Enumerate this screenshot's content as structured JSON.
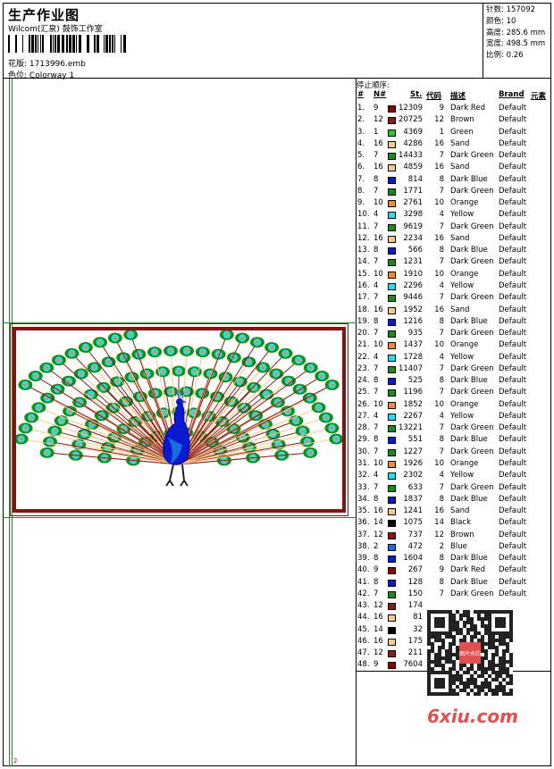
{
  "header": {
    "title": "生产作业图",
    "company": "Wilcom(汇泉) 鼓饰工作室",
    "design_label": "花版:",
    "design_value": "1713996.emb",
    "colorway_label": "色位:",
    "colorway_value": "Colorway 1"
  },
  "stats": [
    {
      "label": "针数:",
      "value": "157092"
    },
    {
      "label": "颜色:",
      "value": "10"
    },
    {
      "label": "高度:",
      "value": "285.6 mm"
    },
    {
      "label": "宽度:",
      "value": "498.5 mm"
    },
    {
      "label": "比例:",
      "value": "0.26"
    }
  ],
  "stop_sequence": {
    "title": "停止顺序:",
    "columns": {
      "num": "#",
      "needle": "N#",
      "stitches": "St.",
      "code": "代码",
      "desc": "描述",
      "brand": "Brand",
      "element": "元素"
    },
    "colors": {
      "9": "#8b0000",
      "12": "#8b1a1a",
      "1": "#22cc22",
      "16": "#f7c98a",
      "7": "#1a8a1a",
      "8": "#0a1ad0",
      "10": "#f08a3a",
      "4": "#22e0e8",
      "14": "#000000",
      "2": "#1a6ae0"
    },
    "rows": [
      {
        "n": "1.",
        "nd": "9",
        "st": "12309",
        "code": "9",
        "desc": "Dark Red",
        "brand": "Default"
      },
      {
        "n": "2.",
        "nd": "12",
        "st": "20725",
        "code": "12",
        "desc": "Brown",
        "brand": "Default"
      },
      {
        "n": "3.",
        "nd": "1",
        "st": "4369",
        "code": "1",
        "desc": "Green",
        "brand": "Default"
      },
      {
        "n": "4.",
        "nd": "16",
        "st": "4286",
        "code": "16",
        "desc": "Sand",
        "brand": "Default"
      },
      {
        "n": "5.",
        "nd": "7",
        "st": "14433",
        "code": "7",
        "desc": "Dark Green",
        "brand": "Default"
      },
      {
        "n": "6.",
        "nd": "16",
        "st": "4859",
        "code": "16",
        "desc": "Sand",
        "brand": "Default"
      },
      {
        "n": "7.",
        "nd": "8",
        "st": "814",
        "code": "8",
        "desc": "Dark Blue",
        "brand": "Default"
      },
      {
        "n": "8.",
        "nd": "7",
        "st": "1771",
        "code": "7",
        "desc": "Dark Green",
        "brand": "Default"
      },
      {
        "n": "9.",
        "nd": "10",
        "st": "2761",
        "code": "10",
        "desc": "Orange",
        "brand": "Default"
      },
      {
        "n": "10.",
        "nd": "4",
        "st": "3298",
        "code": "4",
        "desc": "Yellow",
        "brand": "Default"
      },
      {
        "n": "11.",
        "nd": "7",
        "st": "9619",
        "code": "7",
        "desc": "Dark Green",
        "brand": "Default"
      },
      {
        "n": "12.",
        "nd": "16",
        "st": "2234",
        "code": "16",
        "desc": "Sand",
        "brand": "Default"
      },
      {
        "n": "13.",
        "nd": "8",
        "st": "566",
        "code": "8",
        "desc": "Dark Blue",
        "brand": "Default"
      },
      {
        "n": "14.",
        "nd": "7",
        "st": "1231",
        "code": "7",
        "desc": "Dark Green",
        "brand": "Default"
      },
      {
        "n": "15.",
        "nd": "10",
        "st": "1910",
        "code": "10",
        "desc": "Orange",
        "brand": "Default"
      },
      {
        "n": "16.",
        "nd": "4",
        "st": "2296",
        "code": "4",
        "desc": "Yellow",
        "brand": "Default"
      },
      {
        "n": "17.",
        "nd": "7",
        "st": "9446",
        "code": "7",
        "desc": "Dark Green",
        "brand": "Default"
      },
      {
        "n": "18.",
        "nd": "16",
        "st": "1952",
        "code": "16",
        "desc": "Sand",
        "brand": "Default"
      },
      {
        "n": "19.",
        "nd": "8",
        "st": "1216",
        "code": "8",
        "desc": "Dark Blue",
        "brand": "Default"
      },
      {
        "n": "20.",
        "nd": "7",
        "st": "935",
        "code": "7",
        "desc": "Dark Green",
        "brand": "Default"
      },
      {
        "n": "21.",
        "nd": "10",
        "st": "1437",
        "code": "10",
        "desc": "Orange",
        "brand": "Default"
      },
      {
        "n": "22.",
        "nd": "4",
        "st": "1728",
        "code": "4",
        "desc": "Yellow",
        "brand": "Default"
      },
      {
        "n": "23.",
        "nd": "7",
        "st": "11407",
        "code": "7",
        "desc": "Dark Green",
        "brand": "Default"
      },
      {
        "n": "24.",
        "nd": "8",
        "st": "525",
        "code": "8",
        "desc": "Dark Blue",
        "brand": "Default"
      },
      {
        "n": "25.",
        "nd": "7",
        "st": "1196",
        "code": "7",
        "desc": "Dark Green",
        "brand": "Default"
      },
      {
        "n": "26.",
        "nd": "10",
        "st": "1852",
        "code": "10",
        "desc": "Orange",
        "brand": "Default"
      },
      {
        "n": "27.",
        "nd": "4",
        "st": "2267",
        "code": "4",
        "desc": "Yellow",
        "brand": "Default"
      },
      {
        "n": "28.",
        "nd": "7",
        "st": "13221",
        "code": "7",
        "desc": "Dark Green",
        "brand": "Default"
      },
      {
        "n": "29.",
        "nd": "8",
        "st": "551",
        "code": "8",
        "desc": "Dark Blue",
        "brand": "Default"
      },
      {
        "n": "30.",
        "nd": "7",
        "st": "1227",
        "code": "7",
        "desc": "Dark Green",
        "brand": "Default"
      },
      {
        "n": "31.",
        "nd": "10",
        "st": "1926",
        "code": "10",
        "desc": "Orange",
        "brand": "Default"
      },
      {
        "n": "32.",
        "nd": "4",
        "st": "2302",
        "code": "4",
        "desc": "Yellow",
        "brand": "Default"
      },
      {
        "n": "33.",
        "nd": "7",
        "st": "633",
        "code": "7",
        "desc": "Dark Green",
        "brand": "Default"
      },
      {
        "n": "34.",
        "nd": "8",
        "st": "1837",
        "code": "8",
        "desc": "Dark Blue",
        "brand": "Default"
      },
      {
        "n": "35.",
        "nd": "16",
        "st": "1241",
        "code": "16",
        "desc": "Sand",
        "brand": "Default"
      },
      {
        "n": "36.",
        "nd": "14",
        "st": "1075",
        "code": "14",
        "desc": "Black",
        "brand": "Default"
      },
      {
        "n": "37.",
        "nd": "12",
        "st": "737",
        "code": "12",
        "desc": "Brown",
        "brand": "Default"
      },
      {
        "n": "38.",
        "nd": "2",
        "st": "472",
        "code": "2",
        "desc": "Blue",
        "brand": "Default"
      },
      {
        "n": "39.",
        "nd": "8",
        "st": "1604",
        "code": "8",
        "desc": "Dark Blue",
        "brand": "Default"
      },
      {
        "n": "40.",
        "nd": "9",
        "st": "267",
        "code": "9",
        "desc": "Dark Red",
        "brand": "Default"
      },
      {
        "n": "41.",
        "nd": "8",
        "st": "128",
        "code": "8",
        "desc": "Dark Blue",
        "brand": "Default"
      },
      {
        "n": "42.",
        "nd": "7",
        "st": "150",
        "code": "7",
        "desc": "Dark Green",
        "brand": "Default"
      },
      {
        "n": "43.",
        "nd": "12",
        "st": "174",
        "code": "",
        "desc": "",
        "brand": ""
      },
      {
        "n": "44.",
        "nd": "16",
        "st": "81",
        "code": "",
        "desc": "",
        "brand": ""
      },
      {
        "n": "45.",
        "nd": "14",
        "st": "32",
        "code": "",
        "desc": "",
        "brand": ""
      },
      {
        "n": "46.",
        "nd": "16",
        "st": "175",
        "code": "",
        "desc": "",
        "brand": ""
      },
      {
        "n": "47.",
        "nd": "12",
        "st": "211",
        "code": "",
        "desc": "",
        "brand": ""
      },
      {
        "n": "48.",
        "nd": "9",
        "st": "7604",
        "code": "",
        "desc": "",
        "brand": ""
      }
    ]
  },
  "canvas_mark": "2",
  "watermark": "6xiu.com",
  "qr_stamp": "图片水印"
}
